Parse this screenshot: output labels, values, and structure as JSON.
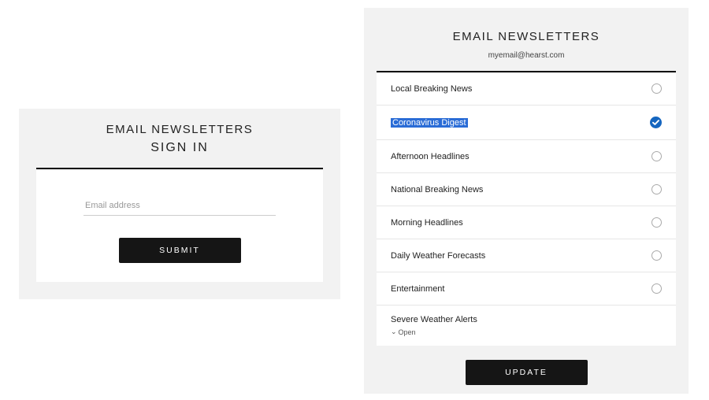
{
  "left": {
    "title": "EMAIL NEWSLETTERS",
    "subtitle": "SIGN IN",
    "email_placeholder": "Email address",
    "submit_label": "SUBMIT"
  },
  "right": {
    "title": "EMAIL NEWSLETTERS",
    "email": "myemail@hearst.com",
    "newsletters": [
      {
        "label": "Local Breaking News",
        "checked": false
      },
      {
        "label": "Coronavirus Digest",
        "checked": true,
        "highlighted": true
      },
      {
        "label": "Afternoon Headlines",
        "checked": false
      },
      {
        "label": "National Breaking News",
        "checked": false
      },
      {
        "label": "Morning Headlines",
        "checked": false
      },
      {
        "label": "Daily Weather Forecasts",
        "checked": false
      },
      {
        "label": "Entertainment",
        "checked": false
      },
      {
        "label": "Severe Weather Alerts",
        "checked": false,
        "expandable": true,
        "open_label": "Open"
      }
    ],
    "update_label": "UPDATE"
  }
}
